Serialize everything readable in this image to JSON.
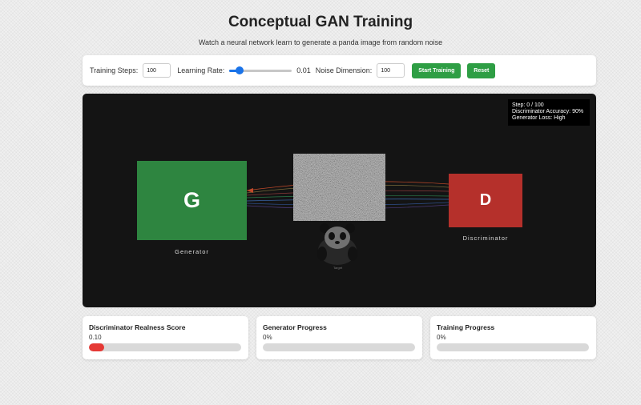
{
  "header": {
    "title": "Conceptual GAN Training",
    "subtitle": "Watch a neural network learn to generate a panda image from random noise"
  },
  "controls": {
    "steps_label": "Training Steps:",
    "steps_value": "100",
    "lr_label": "Learning Rate:",
    "lr_value": "0.01",
    "lr_slider_fraction": 0.12,
    "noise_label": "Noise Dimension:",
    "noise_value": "100",
    "start_label": "Start Training",
    "reset_label": "Reset",
    "button_color": "#2e9e44"
  },
  "canvas": {
    "stats": {
      "step": "Step: 0 / 100",
      "accuracy": "Discriminator Accuracy: 90%",
      "loss": "Generator Loss: High"
    },
    "generator": {
      "letter": "G",
      "label": "Generator",
      "color": "#2e8540"
    },
    "discriminator": {
      "letter": "D",
      "label": "Discriminator",
      "color": "#b5302b"
    },
    "panda_caption": "Target"
  },
  "metrics": [
    {
      "title": "Discriminator Realness Score",
      "value": "0.10",
      "fraction": 0.1,
      "color": "#e53935"
    },
    {
      "title": "Generator Progress",
      "value": "0%",
      "fraction": 0,
      "color": "#2e9e44"
    },
    {
      "title": "Training Progress",
      "value": "0%",
      "fraction": 0,
      "color": "#1a73e8"
    }
  ]
}
